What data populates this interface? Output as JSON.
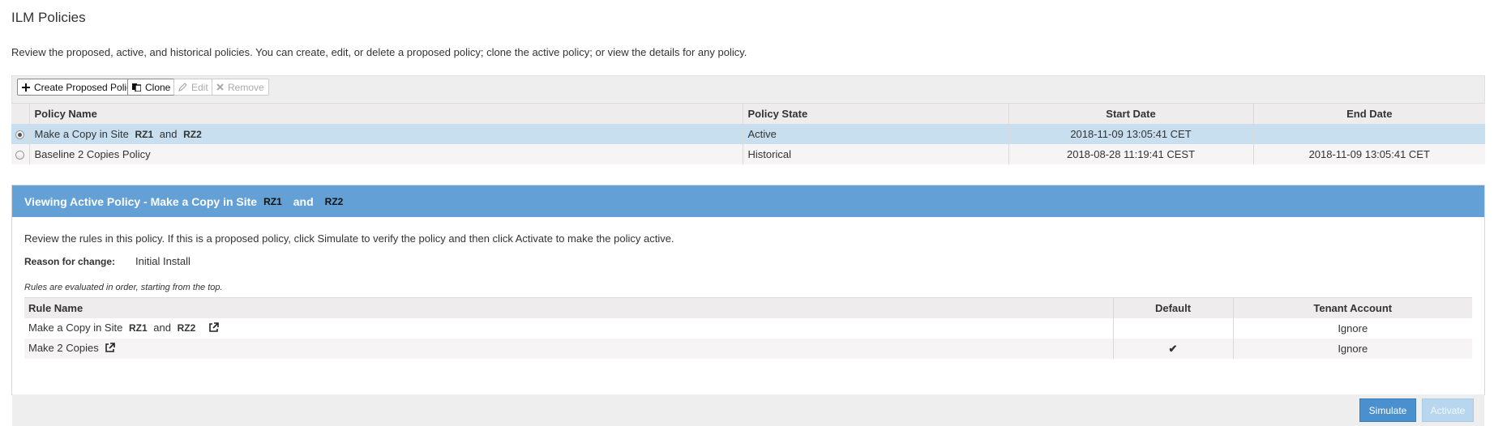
{
  "page": {
    "title": "ILM Policies",
    "intro": "Review the proposed, active, and historical policies. You can create, edit, or delete a proposed policy; clone the active policy; or view the details for any policy."
  },
  "toolbar": {
    "create_label": "Create Proposed Policy",
    "clone_label": "Clone",
    "edit_label": "Edit",
    "remove_label": "Remove"
  },
  "policies": {
    "headers": {
      "name": "Policy Name",
      "state": "Policy State",
      "start": "Start Date",
      "end": "End Date"
    },
    "rows": [
      {
        "name_prefix": "Make a Copy in Site",
        "site1": "RZ1",
        "and": "and",
        "site2": "RZ2",
        "state": "Active",
        "start": "2018-11-09 13:05:41 CET",
        "end": "",
        "selected": true
      },
      {
        "name": "Baseline 2 Copies Policy",
        "state": "Historical",
        "start": "2018-08-28 11:19:41 CEST",
        "end": "2018-11-09 13:05:41 CET",
        "selected": false
      }
    ]
  },
  "active_panel": {
    "heading_prefix": "Viewing Active Policy - Make a Copy in Site",
    "site1": "RZ1",
    "and": "and",
    "site2": "RZ2",
    "review_text": "Review the rules in this policy. If this is a proposed policy, click Simulate to verify the policy and then click Activate to make the policy active.",
    "reason_label": "Reason for change:",
    "reason_value": "Initial Install",
    "rules_note": "Rules are evaluated in order, starting from the top.",
    "rules_headers": {
      "name": "Rule Name",
      "default": "Default",
      "tenant": "Tenant Account"
    },
    "rules": [
      {
        "name_prefix": "Make a Copy in Site",
        "site1": "RZ1",
        "and": "and",
        "site2": "RZ2",
        "default": false,
        "tenant": "Ignore"
      },
      {
        "name": "Make 2 Copies",
        "default": true,
        "default_mark": "✔",
        "tenant": "Ignore"
      }
    ],
    "simulate_label": "Simulate",
    "activate_label": "Activate"
  },
  "colors": {
    "accent": "#62a0d6",
    "selected_row": "#c8dff0",
    "primary_button": "#4a90cf"
  }
}
